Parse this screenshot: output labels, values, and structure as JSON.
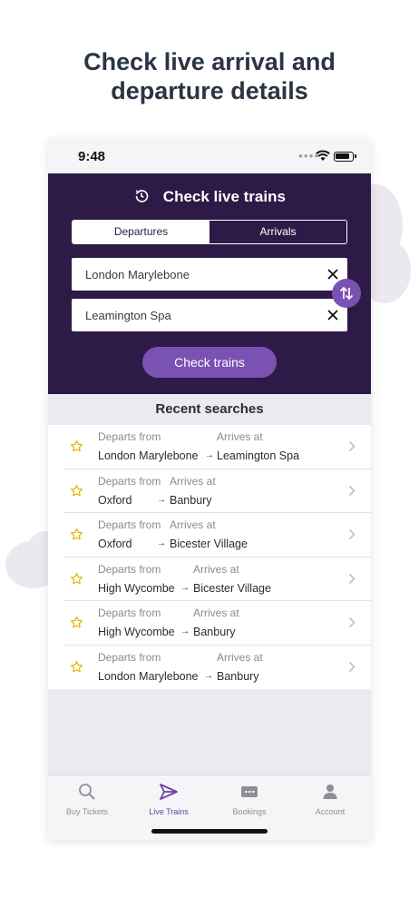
{
  "headline": {
    "line1": "Check live arrival and",
    "line2": "departure details"
  },
  "status": {
    "time": "9:48"
  },
  "live": {
    "title": "Check live trains",
    "tabs": {
      "departures": "Departures",
      "arrivals": "Arrivals",
      "selected": "Departures"
    },
    "from_value": "London Marylebone",
    "to_value": "Leamington Spa",
    "check_button": "Check trains"
  },
  "recent": {
    "title": "Recent searches",
    "departs_label": "Departs from",
    "arrives_label": "Arrives at",
    "arrow": "→",
    "items": [
      {
        "from": "London Marylebone",
        "to": "Leamington Spa"
      },
      {
        "from": "Oxford",
        "to": "Banbury"
      },
      {
        "from": "Oxford",
        "to": "Bicester Village"
      },
      {
        "from": "High Wycombe",
        "to": "Bicester Village"
      },
      {
        "from": "High Wycombe",
        "to": "Banbury"
      },
      {
        "from": "London Marylebone",
        "to": "Banbury"
      }
    ]
  },
  "tabbar": {
    "items": [
      {
        "label": "Buy Tickets",
        "icon": "search-icon"
      },
      {
        "label": "Live Trains",
        "icon": "send-icon",
        "active": true
      },
      {
        "label": "Bookings",
        "icon": "ticket-icon"
      },
      {
        "label": "Account",
        "icon": "person-icon"
      }
    ]
  },
  "colors": {
    "brand_dark": "#2e1a47",
    "accent": "#7a52b3",
    "star": "#e6b800"
  }
}
